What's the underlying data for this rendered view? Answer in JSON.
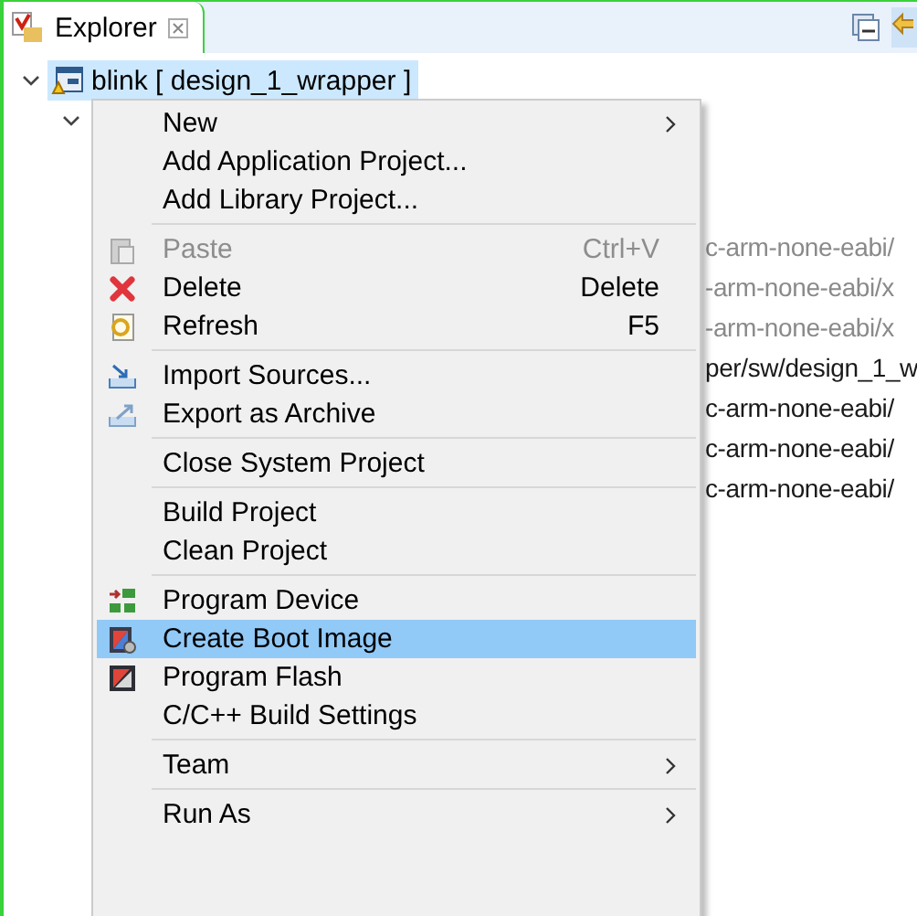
{
  "panel": {
    "tab": {
      "title": "Explorer",
      "selected": true
    }
  },
  "tree": {
    "root": {
      "label": "blink [ design_1_wrapper ]",
      "expanded": true,
      "selected": true
    },
    "child": {
      "expanded": true
    },
    "fragments": [
      {
        "text": "c-arm-none-eabi/",
        "dimmed": true
      },
      {
        "text": "-arm-none-eabi/x",
        "dimmed": true
      },
      {
        "text": "-arm-none-eabi/x",
        "dimmed": true
      },
      {
        "text": "per/sw/design_1_w",
        "dimmed": false
      },
      {
        "text": "c-arm-none-eabi/",
        "dimmed": false
      },
      {
        "text": "c-arm-none-eabi/",
        "dimmed": false
      },
      {
        "text": "c-arm-none-eabi/",
        "dimmed": false
      }
    ]
  },
  "context_menu": {
    "groups": [
      [
        {
          "label": "New",
          "kind": "plain",
          "submenu": true,
          "disabled": false,
          "selected": false
        },
        {
          "label": "Add Application Project...",
          "kind": "plain",
          "submenu": false,
          "disabled": false,
          "selected": false
        },
        {
          "label": "Add Library Project...",
          "kind": "plain",
          "submenu": false,
          "disabled": false,
          "selected": false
        }
      ],
      [
        {
          "label": "Paste",
          "shortcut": "Ctrl+V",
          "kind": "paste",
          "submenu": false,
          "disabled": true,
          "selected": false
        },
        {
          "label": "Delete",
          "shortcut": "Delete",
          "kind": "delete",
          "submenu": false,
          "disabled": false,
          "selected": false
        },
        {
          "label": "Refresh",
          "shortcut": "F5",
          "kind": "refresh",
          "submenu": false,
          "disabled": false,
          "selected": false
        }
      ],
      [
        {
          "label": "Import Sources...",
          "kind": "import",
          "submenu": false,
          "disabled": false,
          "selected": false
        },
        {
          "label": "Export as Archive",
          "kind": "export",
          "submenu": false,
          "disabled": false,
          "selected": false
        }
      ],
      [
        {
          "label": "Close System Project",
          "kind": "plain",
          "submenu": false,
          "disabled": false,
          "selected": false
        }
      ],
      [
        {
          "label": "Build Project",
          "kind": "plain",
          "submenu": false,
          "disabled": false,
          "selected": false
        },
        {
          "label": "Clean Project",
          "kind": "plain",
          "submenu": false,
          "disabled": false,
          "selected": false
        }
      ],
      [
        {
          "label": "Program Device",
          "kind": "device",
          "submenu": false,
          "disabled": false,
          "selected": false
        },
        {
          "label": "Create Boot Image",
          "kind": "boot",
          "submenu": false,
          "disabled": false,
          "selected": true
        },
        {
          "label": "Program Flash",
          "kind": "flash",
          "submenu": false,
          "disabled": false,
          "selected": false
        },
        {
          "label": "C/C++ Build Settings",
          "kind": "plain",
          "submenu": false,
          "disabled": false,
          "selected": false
        }
      ],
      [
        {
          "label": "Team",
          "kind": "plain",
          "submenu": true,
          "disabled": false,
          "selected": false
        }
      ],
      [
        {
          "label": "Run As",
          "kind": "plain",
          "submenu": true,
          "disabled": false,
          "selected": false
        }
      ]
    ]
  }
}
